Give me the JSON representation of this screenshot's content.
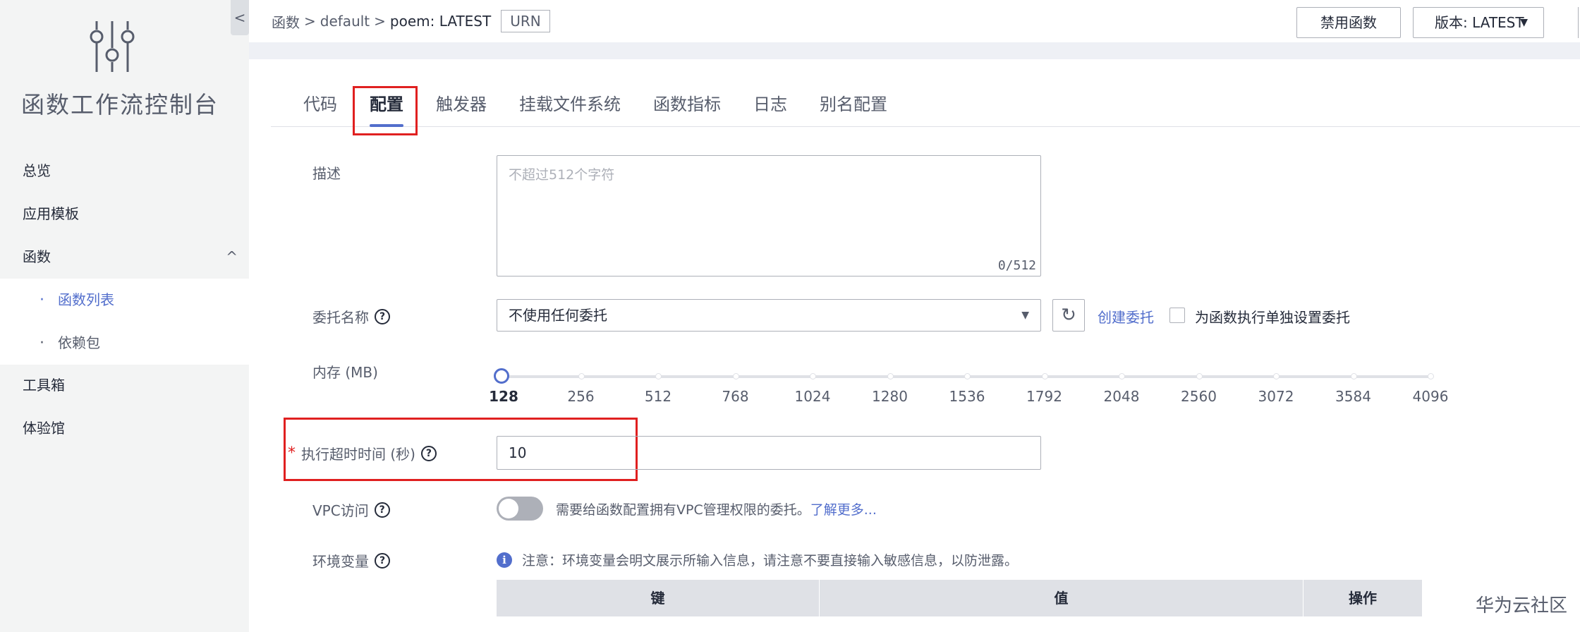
{
  "sidebar": {
    "title": "函数工作流控制台",
    "items": [
      {
        "label": "总览"
      },
      {
        "label": "应用模板"
      },
      {
        "label": "函数"
      },
      {
        "label": "工具箱"
      },
      {
        "label": "体验馆"
      }
    ],
    "subitems": [
      {
        "label": "函数列表"
      },
      {
        "label": "依赖包"
      }
    ],
    "collapse_glyph": "<",
    "expand_glyph": "^"
  },
  "breadcrumb": {
    "root": "函数",
    "middle": "default",
    "current": "poem: LATEST",
    "separator": ">",
    "urn_label": "URN"
  },
  "toolbar": {
    "disable_label": "禁用函数",
    "version_label": "版本: LATEST"
  },
  "tabs": [
    {
      "label": "代码"
    },
    {
      "label": "配置"
    },
    {
      "label": "触发器"
    },
    {
      "label": "挂载文件系统"
    },
    {
      "label": "函数指标"
    },
    {
      "label": "日志"
    },
    {
      "label": "别名配置"
    }
  ],
  "form": {
    "description": {
      "label": "描述",
      "placeholder": "不超过512个字符",
      "counter": "0/512"
    },
    "agency": {
      "label": "委托名称",
      "value": "不使用任何委托",
      "create_link": "创建委托",
      "checkbox_label": "为函数执行单独设置委托"
    },
    "memory": {
      "label": "内存 (MB)",
      "options": [
        "128",
        "256",
        "512",
        "768",
        "1024",
        "1280",
        "1536",
        "1792",
        "2048",
        "2560",
        "3072",
        "3584",
        "4096"
      ],
      "selected": "128"
    },
    "timeout": {
      "required_mark": "*",
      "label": "执行超时时间 (秒)",
      "value": "10"
    },
    "vpc": {
      "label": "VPC访问",
      "enabled": false,
      "hint": "需要给函数配置拥有VPC管理权限的委托。",
      "link": "了解更多..."
    },
    "env": {
      "label": "环境变量",
      "note": "注意：环境变量会明文展示所输入信息，请注意不要直接输入敏感信息，以防泄露。",
      "columns": [
        "键",
        "值",
        "操作"
      ]
    }
  },
  "watermark": "华为云社区",
  "colors": {
    "accent": "#526ecc",
    "highlight": "#e02020",
    "text": "#252b3a",
    "muted": "#575d6c",
    "border": "#adb0b8"
  }
}
